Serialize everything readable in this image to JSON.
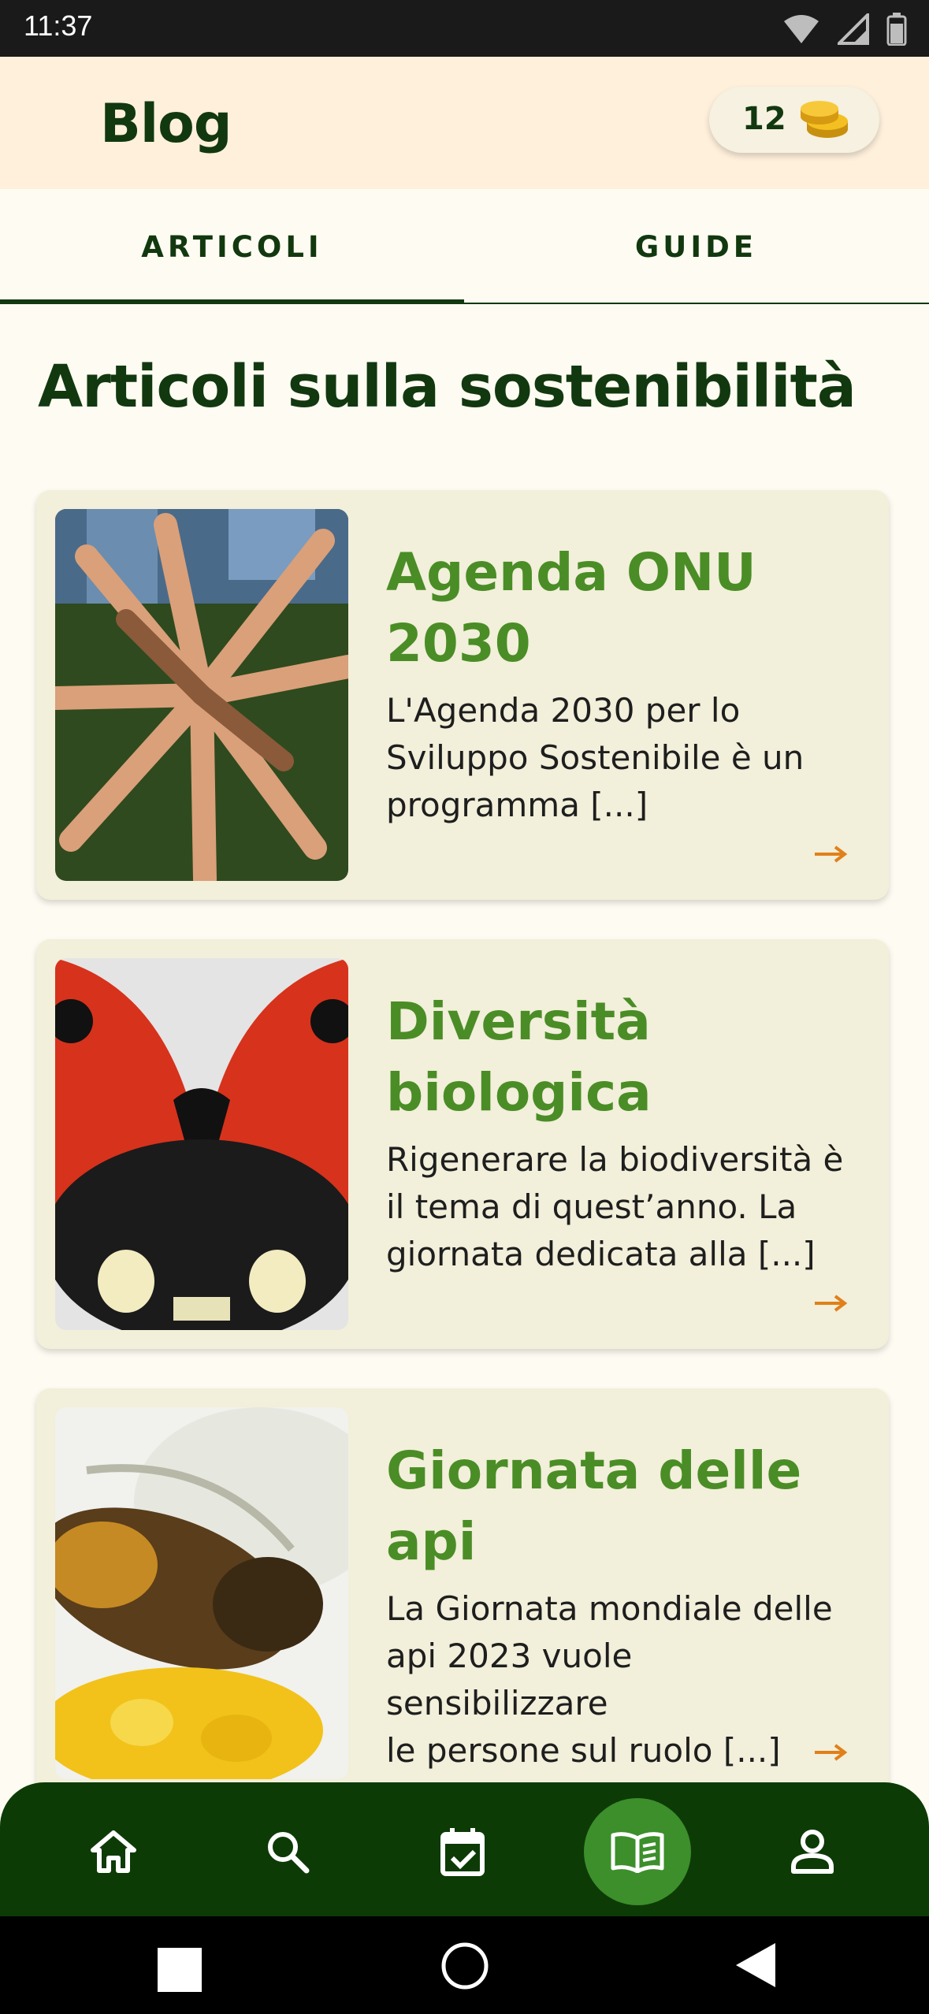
{
  "status_bar": {
    "time": "11:37"
  },
  "app_bar": {
    "title": "Blog",
    "coin_count": "12"
  },
  "tabs": [
    {
      "label": "ARTICOLI",
      "active": true
    },
    {
      "label": "GUIDE",
      "active": false
    }
  ],
  "section_title": "Articoli sulla sostenibilità",
  "articles": [
    {
      "title_lines": [
        "Agenda ONU",
        "2030"
      ],
      "excerpt_lines": [
        "L'Agenda 2030 per lo",
        "Sviluppo Sostenibile è un",
        "programma [...]"
      ],
      "image": "hands-together-photo"
    },
    {
      "title_lines": [
        "Diversità",
        "biologica"
      ],
      "excerpt_lines": [
        "Rigenerare la biodiversità è",
        "il tema di quest’anno. La",
        "giornata dedicata alla [...]"
      ],
      "image": "ladybug-photo"
    },
    {
      "title_lines": [
        "Giornata delle",
        "api"
      ],
      "excerpt_lines": [
        "La Giornata mondiale delle",
        "api 2023 vuole sensibilizzare",
        "le persone sul ruolo [...]"
      ],
      "image": "bee-photo"
    }
  ],
  "bottom_nav": {
    "items": [
      "home-icon",
      "search-icon",
      "calendar-check-icon",
      "book-icon",
      "person-icon"
    ],
    "active": "book-icon"
  },
  "colors": {
    "primary_dark": "#12380f",
    "accent_green": "#4a8d26",
    "accent_orange": "#e0801a",
    "app_bar_bg": "#fff0dc",
    "card_bg": "#f2efda",
    "nav_bg": "#0d3b06"
  }
}
